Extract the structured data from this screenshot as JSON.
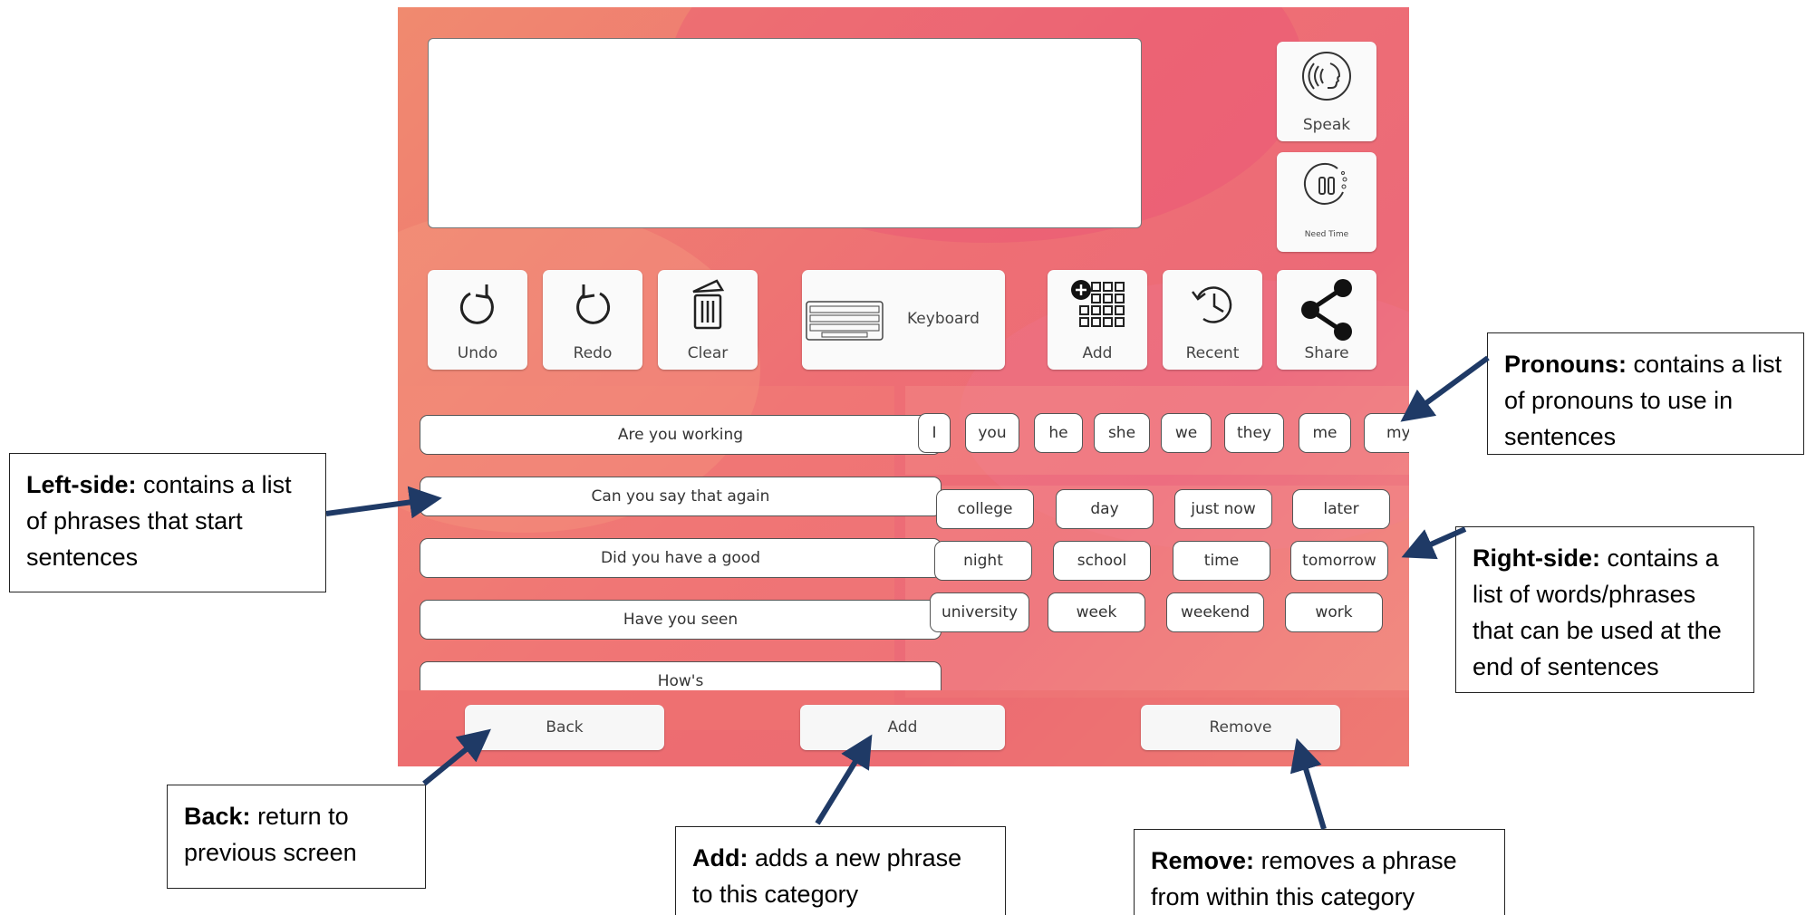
{
  "toolbar": {
    "undo": "Undo",
    "redo": "Redo",
    "clear": "Clear",
    "keyboard": "Keyboard",
    "add": "Add",
    "recent": "Recent",
    "share": "Share"
  },
  "side_buttons": {
    "speak": "Speak",
    "need_time": "Need Time"
  },
  "phrases": [
    "Are you working",
    "Can you say that again",
    "Did you have a good",
    "Have you seen",
    "How's"
  ],
  "pronouns": [
    "I",
    "you",
    "he",
    "she",
    "we",
    "they",
    "me",
    "my"
  ],
  "words": [
    "college",
    "day",
    "just now",
    "later",
    "night",
    "school",
    "time",
    "tomorrow",
    "university",
    "week",
    "weekend",
    "work"
  ],
  "footer": {
    "back": "Back",
    "add": "Add",
    "remove": "Remove"
  },
  "callouts": {
    "pronouns": {
      "title": "Pronouns:",
      "text": "contains a list of pronouns to use in sentences"
    },
    "left": {
      "title": "Left-side:",
      "text": "contains  a list of phrases that start sentences"
    },
    "right": {
      "title": "Right-side:",
      "text": "contains a list of words/phrases that can be used at the end of sentences"
    },
    "back": {
      "title": "Back:",
      "text": "return to previous screen"
    },
    "add": {
      "title": "Add:",
      "text": "adds a new phrase to this category"
    },
    "remove": {
      "title": "Remove:",
      "text": "removes a phrase from within this category"
    }
  },
  "colors": {
    "arrow": "#1f3a66",
    "app_primary": "#ee6f74"
  }
}
